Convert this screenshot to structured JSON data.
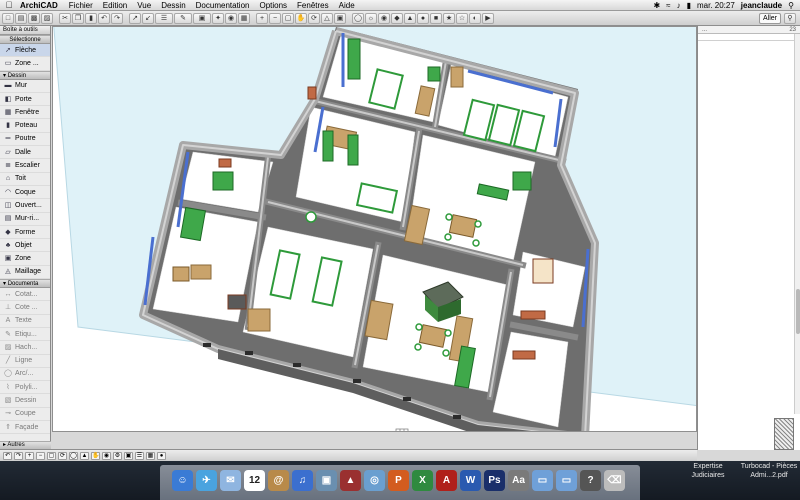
{
  "menubar": {
    "apple": "",
    "app_name": "ArchiCAD",
    "menus": [
      "Fichier",
      "Edition",
      "Vue",
      "Dessin",
      "Documentation",
      "Options",
      "Fenêtres",
      "Aide"
    ],
    "clock": "mar. 20:27",
    "user": "jeanclaude"
  },
  "toolbar": {
    "goto_label": "Aller",
    "page_number": "23"
  },
  "toolbox": {
    "title": "Boîte à outils",
    "select_header": "Sélectionne",
    "select_tools": [
      {
        "label": "Flèche",
        "icon": "arrow-icon"
      },
      {
        "label": "Zone ...",
        "icon": "marquee-icon"
      }
    ],
    "design_header": "Dessin",
    "design_tools": [
      {
        "label": "Mur",
        "icon": "wall-icon"
      },
      {
        "label": "Porte",
        "icon": "door-icon"
      },
      {
        "label": "Fenêtre",
        "icon": "window-icon"
      },
      {
        "label": "Poteau",
        "icon": "column-icon"
      },
      {
        "label": "Poutre",
        "icon": "beam-icon"
      },
      {
        "label": "Dalle",
        "icon": "slab-icon"
      },
      {
        "label": "Escalier",
        "icon": "stair-icon"
      },
      {
        "label": "Toit",
        "icon": "roof-icon"
      },
      {
        "label": "Coque",
        "icon": "shell-icon"
      },
      {
        "label": "Ouvert...",
        "icon": "opening-icon"
      },
      {
        "label": "Mur-ri...",
        "icon": "curtain-wall-icon"
      },
      {
        "label": "Forme",
        "icon": "morph-icon"
      },
      {
        "label": "Objet",
        "icon": "object-icon"
      },
      {
        "label": "Zone",
        "icon": "zone-icon"
      },
      {
        "label": "Maillage",
        "icon": "mesh-icon"
      }
    ],
    "doc_header": "Documenta",
    "doc_tools": [
      {
        "label": "Cotat...",
        "icon": "dimension-icon"
      },
      {
        "label": "Cote ...",
        "icon": "level-dimension-icon"
      },
      {
        "label": "Texte",
        "icon": "text-icon"
      },
      {
        "label": "Etiqu...",
        "icon": "label-icon"
      },
      {
        "label": "Hach...",
        "icon": "fill-icon"
      },
      {
        "label": "Ligne",
        "icon": "line-icon"
      },
      {
        "label": "Arc/...",
        "icon": "arc-icon"
      },
      {
        "label": "Polyli...",
        "icon": "polyline-icon"
      },
      {
        "label": "Dessin",
        "icon": "drawing-icon"
      },
      {
        "label": "Coupe",
        "icon": "section-icon"
      },
      {
        "label": "Façade",
        "icon": "elevation-icon"
      }
    ],
    "more_header": "Autres"
  },
  "dock": {
    "documents": [
      {
        "line1": "Expertise",
        "line2": "Judiciaires"
      },
      {
        "line1": "Turbocad - Pièces",
        "line2": "Admi...2.pdf"
      }
    ],
    "calendar_day": "12",
    "apps": [
      "finder-icon",
      "safari-icon",
      "mail-icon",
      "calendar-icon",
      "address-book-icon",
      "itunes-icon",
      "iphoto-icon",
      "archicad-icon",
      "preview-icon",
      "powerpoint-icon",
      "excel-icon",
      "acrobat-icon",
      "word-icon",
      "photoshop-icon",
      "dictionary-icon",
      "folder-icon",
      "folder-icon",
      "help-icon",
      "trash-icon"
    ]
  },
  "colors": {
    "wall": "#8e8e8e",
    "wall_top": "#c9c9c9",
    "floor": "#ffffff",
    "furniture": "#2e9a3a",
    "wood": "#c9a36b",
    "window_blue": "#4a6fd0",
    "door_red": "#b04a2a",
    "plane": "#dff2f8"
  }
}
